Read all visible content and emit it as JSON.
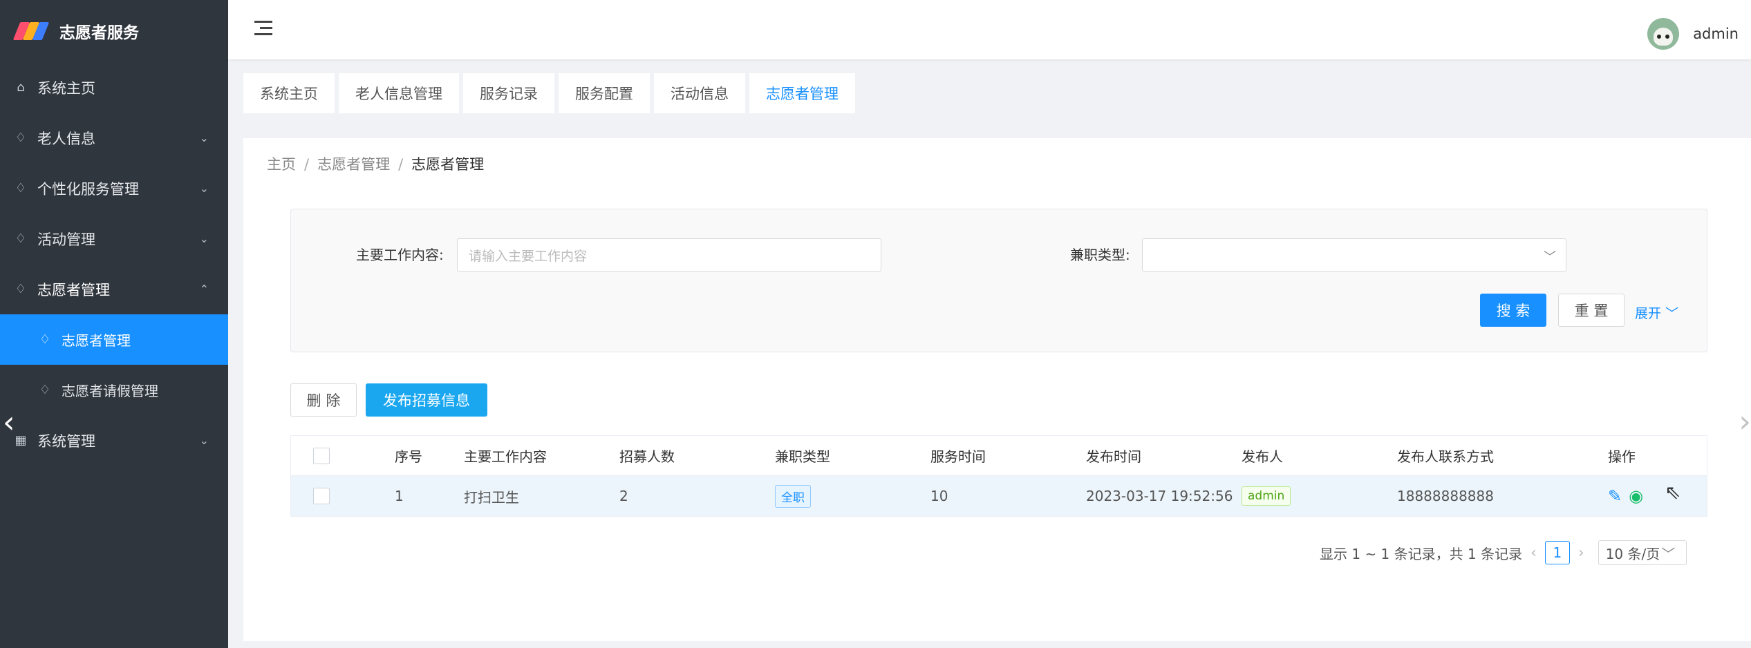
{
  "sidebar": {
    "app_name": "志愿者服务",
    "items": [
      {
        "label": "系统主页",
        "icon": "home-icon",
        "has_chevron": false
      },
      {
        "label": "老人信息",
        "icon": "flame-icon",
        "has_chevron": true
      },
      {
        "label": "个性化服务管理",
        "icon": "flame-icon",
        "has_chevron": true
      },
      {
        "label": "活动管理",
        "icon": "flame-icon",
        "has_chevron": true
      },
      {
        "label": "志愿者管理",
        "icon": "flame-icon",
        "has_chevron": true,
        "expanded": true
      },
      {
        "label": "志愿者管理",
        "icon": "flame-icon",
        "sub": true,
        "active": true
      },
      {
        "label": "志愿者请假管理",
        "icon": "flame-icon",
        "sub": true
      },
      {
        "label": "系统管理",
        "icon": "grid-icon",
        "has_chevron": true
      }
    ]
  },
  "header": {
    "user_name": "admin"
  },
  "tabs": [
    "系统主页",
    "老人信息管理",
    "服务记录",
    "服务配置",
    "活动信息",
    "志愿者管理"
  ],
  "active_tab": "志愿者管理",
  "breadcrumb": {
    "home": "主页",
    "level1": "志愿者管理",
    "level2": "志愿者管理"
  },
  "search": {
    "work_label": "主要工作内容:",
    "work_placeholder": "请输入主要工作内容",
    "type_label": "兼职类型:",
    "type_value": "",
    "search_btn": "搜 索",
    "reset_btn": "重 置",
    "expand_label": "展开"
  },
  "actions": {
    "delete_btn": "删 除",
    "publish_btn": "发布招募信息"
  },
  "table": {
    "headers": [
      "序号",
      "主要工作内容",
      "招募人数",
      "兼职类型",
      "服务时间",
      "发布时间",
      "发布人",
      "发布人联系方式",
      "操作"
    ],
    "rows": [
      {
        "index": "1",
        "work": "打扫卫生",
        "count": "2",
        "type": "全职",
        "hours": "10",
        "published_at": "2023-03-17 19:52:56",
        "publisher": "admin",
        "contact": "18888888888"
      }
    ]
  },
  "pagination": {
    "summary": "显示 1 ~ 1 条记录，共 1 条记录",
    "current": "1",
    "page_size": "10 条/页"
  },
  "colors": {
    "sidebar_bg": "#30363e",
    "primary": "#1890ff",
    "active_row": "#ecf5fb"
  }
}
